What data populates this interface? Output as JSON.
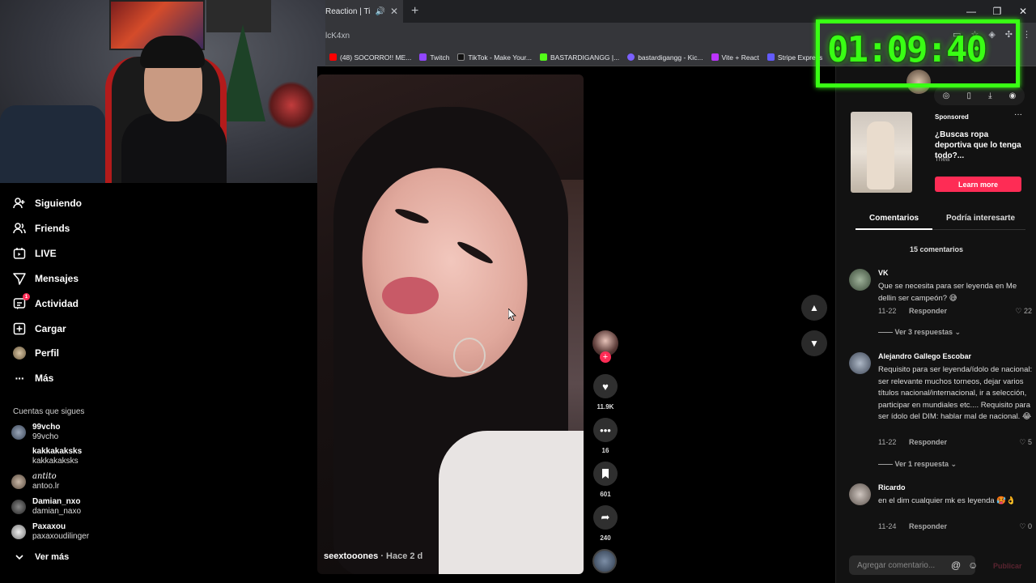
{
  "browser": {
    "tab_title": "Reaction | TikTok",
    "tab_speaker": "🔊",
    "tab_close": "✕",
    "new_tab": "+",
    "url": "lcK4xn",
    "bookmarks": [
      {
        "label": "(48) SOCORRO!! ME...",
        "color": "#ff0000"
      },
      {
        "label": "Twitch",
        "color": "#9146ff"
      },
      {
        "label": "TikTok - Make Your...",
        "color": "#000000"
      },
      {
        "label": "BASTARDIGANGG |...",
        "color": "#53fc18"
      },
      {
        "label": "bastardigangg - Kic...",
        "color": "#7b61ff"
      },
      {
        "label": "Vite + React",
        "color": "#bd34fe"
      },
      {
        "label": "Stripe Express",
        "color": "#635bff"
      }
    ]
  },
  "sidebar": {
    "nav": [
      {
        "label": "Siguiendo",
        "icon": "user-plus-icon"
      },
      {
        "label": "Friends",
        "icon": "friends-icon"
      },
      {
        "label": "LIVE",
        "icon": "live-icon"
      },
      {
        "label": "Mensajes",
        "icon": "send-icon"
      },
      {
        "label": "Actividad",
        "icon": "activity-icon",
        "badge": "1"
      },
      {
        "label": "Cargar",
        "icon": "upload-icon"
      },
      {
        "label": "Perfil",
        "icon": "profile-avatar"
      },
      {
        "label": "Más",
        "icon": "more-icon"
      }
    ],
    "following_title": "Cuentas que sigues",
    "following": [
      {
        "username": "99vcho",
        "name": "99vcho"
      },
      {
        "username": "kakkakaksks",
        "name": "kakkakaksks"
      },
      {
        "username": "antito",
        "name": "antoo.lr"
      },
      {
        "username": "Damian_nxo",
        "name": "damian_naxo"
      },
      {
        "username": "Paxaxou",
        "name": "paxaxoudilinger"
      }
    ],
    "see_more": "Ver más"
  },
  "video": {
    "author": "seextooones",
    "posted": "· Hace 2 d",
    "likes": "11.9K",
    "comments": "16",
    "saves": "601",
    "shares": "240"
  },
  "ad": {
    "sponsored": "Sponsored",
    "title": "¿Buscas ropa deportiva que lo tenga todo?...",
    "brand": "Thea",
    "cta": "Learn more",
    "more": "···"
  },
  "panel": {
    "tab_comments": "Comentarios",
    "tab_interest": "Podría interesarte",
    "count": "15 comentarios",
    "comments": [
      {
        "name": "VK",
        "text": "Que se necesita para ser leyenda en Me dellin ser campeón? 😅",
        "date": "11-22",
        "reply": "Responder",
        "likes": "22",
        "more": "—— Ver 3 respuestas ⌄"
      },
      {
        "name": "Alejandro Gallego Escobar",
        "text": "Requisito para ser leyenda/ídolo de nacional: ser relevante muchos torneos, dejar varios títulos nacional/internacional, ir a selección, participar en mundiales etc.... Requisito para ser ídolo del DIM: hablar mal de nacional. 😂",
        "date": "11-22",
        "reply": "Responder",
        "likes": "5",
        "more": "—— Ver 1 respuesta ⌄"
      },
      {
        "name": "Ricardo",
        "text": "en el dim cualquier mk es leyenda 🥵👌",
        "date": "11-24",
        "reply": "Responder",
        "likes": "0",
        "more": ""
      }
    ],
    "input_placeholder": "Agregar comentario...",
    "at": "@",
    "emoji": "☺",
    "post": "Publicar"
  },
  "overlay": {
    "timer": "01:09:40"
  },
  "colors": {
    "accent": "#fe2c55",
    "timer_green": "#39ff14"
  }
}
